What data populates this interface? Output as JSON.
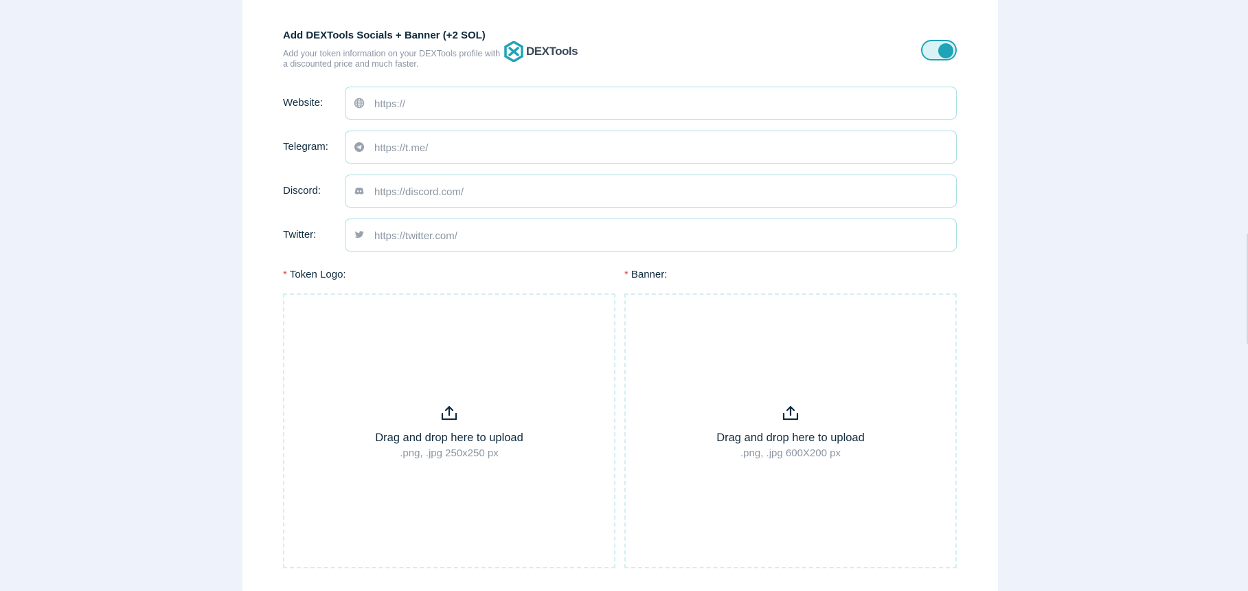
{
  "dextools": {
    "title": "Add DEXTools Socials + Banner (+2 SOL)",
    "description": "Add your token information on your DEXTools profile with a discounted price and much faster.",
    "logo_text": "DEXTools",
    "toggle_on": true
  },
  "fields": [
    {
      "label": "Website:",
      "placeholder": "https://",
      "icon": "globe-icon"
    },
    {
      "label": "Telegram:",
      "placeholder": "https://t.me/",
      "icon": "telegram-icon"
    },
    {
      "label": "Discord:",
      "placeholder": "https://discord.com/",
      "icon": "discord-icon"
    },
    {
      "label": "Twitter:",
      "placeholder": "https://twitter.com/",
      "icon": "twitter-icon"
    }
  ],
  "uploads": {
    "required_mark": "*",
    "logo": {
      "label": "Token Logo:",
      "title": "Drag and drop here to upload",
      "hint": ".png, .jpg 250x250 px"
    },
    "banner": {
      "label": "Banner:",
      "title": "Drag and drop here to upload",
      "hint": ".png, .jpg 600X200 px"
    }
  },
  "colors": {
    "accent": "#1fa3b8",
    "border": "#a6dde5",
    "required": "#e5484d",
    "muted_text": "#8c96a3"
  }
}
